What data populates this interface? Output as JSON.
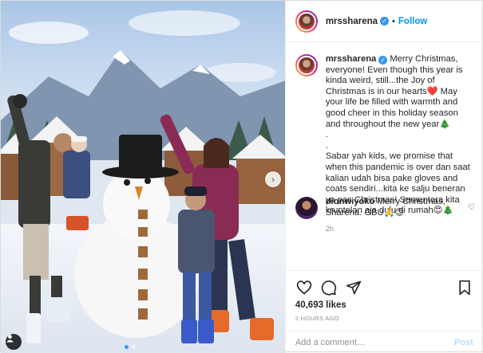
{
  "post": {
    "photo": {
      "alt": "Family posing with a snowman in an indoor snow park",
      "carousel_dots": 2,
      "active_dot": 0
    },
    "header": {
      "username": "mrssharena",
      "separator": "•",
      "follow_label": "Follow"
    },
    "caption": {
      "username": "mrssharena",
      "paragraph1": "Merry Christmas, everyone! Even though this year is kinda weird, still...the Joy of Christmas is in our hearts❤️ May your life be filled with warmth and good cheer in this holiday season and throughout the new year🎄",
      "dot1": ".",
      "dot2": ".",
      "paragraph2": "Sabar yah kids, we promise that when this pandemic is over dan saat kalian udah bisa pake gloves and coats sendiri...kita ke salju beneran ya pas Christmas! Sementara kita kruntelan aja dulu di rumah😍🎄",
      "time": "2h"
    },
    "comment": {
      "username": "dionwiyoko",
      "text": "Merry Christmas, Sharena. GBU🙏😊"
    },
    "actions": {
      "likes": "40,693 likes",
      "posted": "2 HOURS AGO"
    },
    "add_comment": {
      "placeholder": "Add a comment…",
      "post_label": "Post"
    },
    "colors": {
      "accent": "#0095f6",
      "verified": "#3897f0",
      "muted": "#8e8e8e",
      "post_disabled": "#b2dffc"
    }
  }
}
